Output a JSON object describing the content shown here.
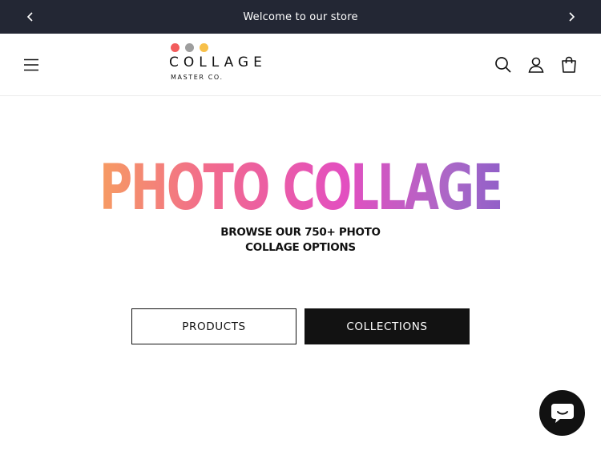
{
  "announcement": {
    "message": "Welcome to our store",
    "prev_icon": "chevron-left-icon",
    "next_icon": "chevron-right-icon",
    "background": "#232734"
  },
  "header": {
    "menu_icon": "hamburger-menu-icon",
    "logo": {
      "name": "COLLAGE",
      "tagline": "MASTER CO.",
      "dot_colors": [
        "#f25c5c",
        "#9e9e9e",
        "#f7c04a"
      ]
    },
    "icons": [
      "search-icon",
      "account-icon",
      "cart-icon"
    ]
  },
  "hero": {
    "title": "PHOTO COLLAGE",
    "subtitle_line1": "BROWSE OUR 750+ PHOTO",
    "subtitle_line2": "COLLAGE OPTIONS",
    "gradient_colors": [
      "#f7a25c",
      "#f1698f",
      "#e34fc0",
      "#a968c7",
      "#8a5cc9"
    ]
  },
  "buttons": {
    "products_label": "PRODUCTS",
    "collections_label": "COLLECTIONS"
  },
  "chat": {
    "icon": "chat-bubble-icon"
  }
}
